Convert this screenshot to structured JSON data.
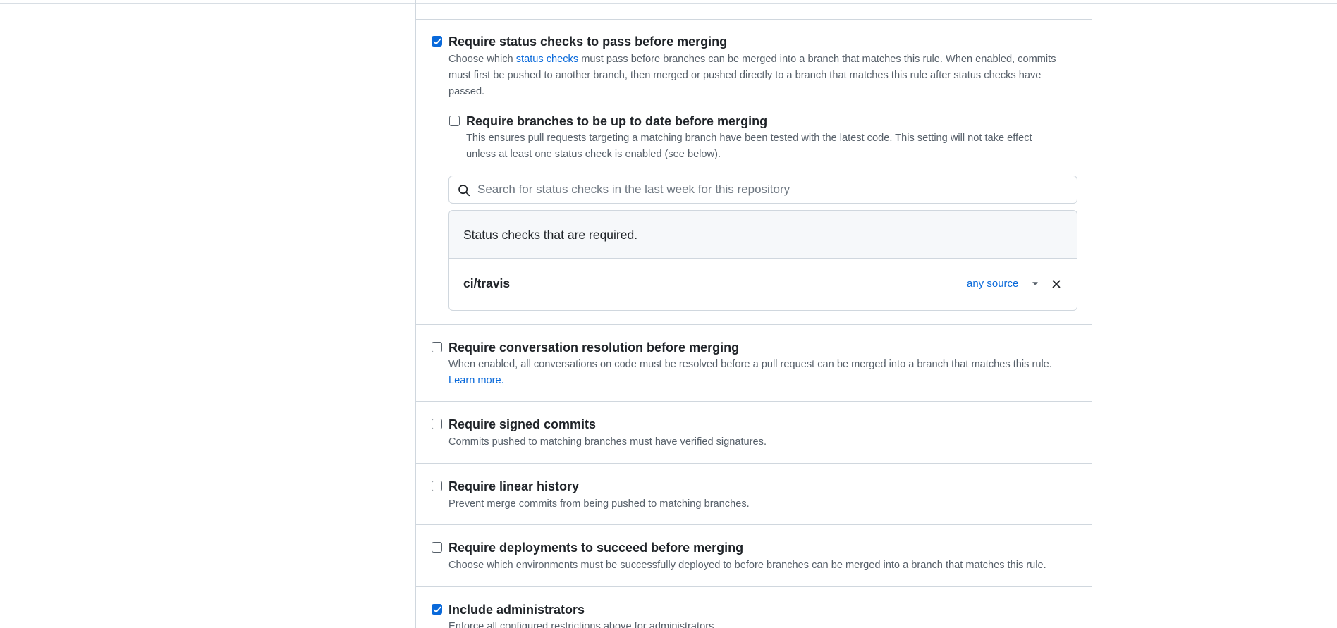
{
  "status_checks": {
    "checked": true,
    "title": "Require status checks to pass before merging",
    "desc_before": "Choose which ",
    "desc_link": "status checks",
    "desc_line1_after": " must pass before branches can be merged into a branch that matches this rule. When enabled, commits",
    "desc_line2": "must first be pushed to another branch, then merged or pushed directly to a branch that matches this rule after status checks have",
    "desc_line3": "passed.",
    "up_to_date": {
      "checked": false,
      "title": "Require branches to be up to date before merging",
      "desc_line1": "This ensures pull requests targeting a matching branch have been tested with the latest code. This setting will not take effect",
      "desc_line2": "unless at least one status check is enabled (see below)."
    },
    "search": {
      "placeholder": "Search for status checks in the last week for this repository",
      "value": ""
    },
    "required_header": "Status checks that are required.",
    "required_checks": [
      {
        "name": "ci/travis",
        "source": "any source"
      }
    ]
  },
  "conversation_resolution": {
    "checked": false,
    "title": "Require conversation resolution before merging",
    "desc": "When enabled, all conversations on code must be resolved before a pull request can be merged into a branch that matches this rule.",
    "link": "Learn more."
  },
  "signed_commits": {
    "checked": false,
    "title": "Require signed commits",
    "desc": "Commits pushed to matching branches must have verified signatures."
  },
  "linear_history": {
    "checked": false,
    "title": "Require linear history",
    "desc": "Prevent merge commits from being pushed to matching branches."
  },
  "deployments": {
    "checked": false,
    "title": "Require deployments to succeed before merging",
    "desc": "Choose which environments must be successfully deployed to before branches can be merged into a branch that matches this rule."
  },
  "include_admins": {
    "checked": true,
    "title": "Include administrators",
    "desc": "Enforce all configured restrictions above for administrators."
  },
  "colors": {
    "accent": "#0969da",
    "border": "#d0d7de",
    "muted_text": "#57606a",
    "header_bg": "#f6f8fa"
  },
  "icons": [
    "search-icon",
    "triangle-down-icon",
    "x-icon",
    "check-icon"
  ]
}
